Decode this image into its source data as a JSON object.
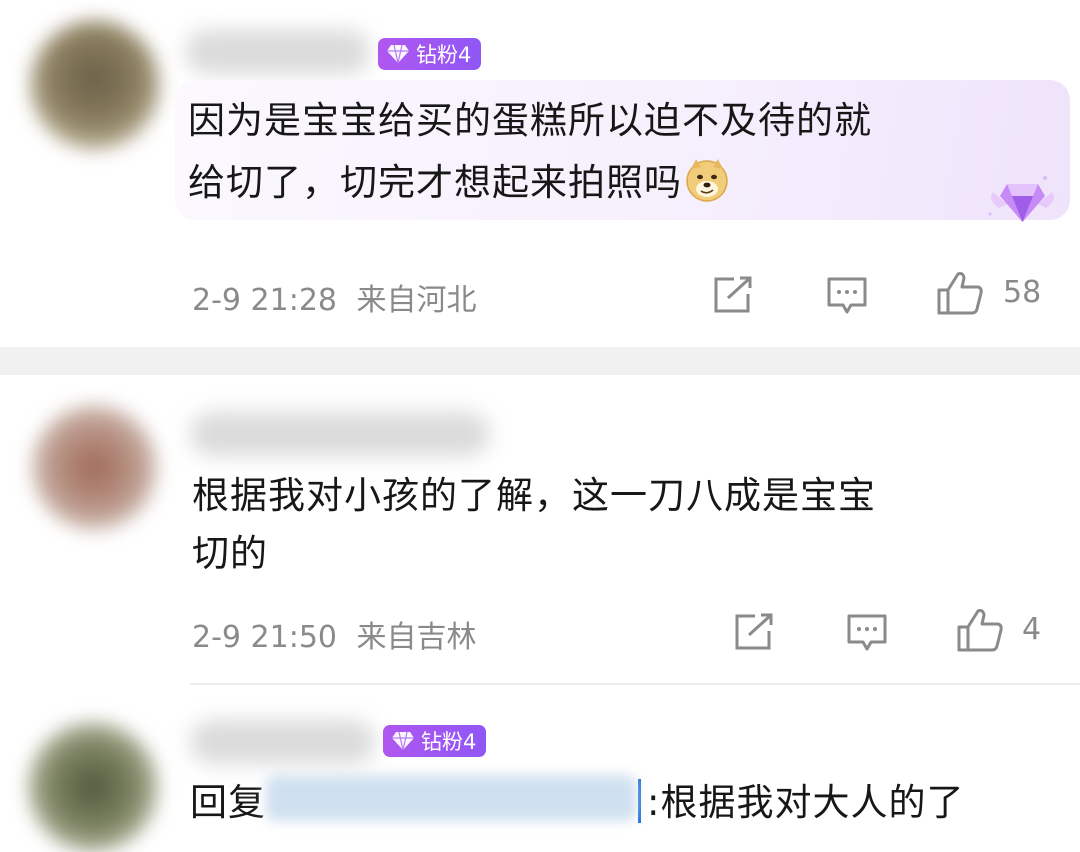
{
  "comments": [
    {
      "badge": "钻粉4",
      "text_line1": "因为是宝宝给买的蛋糕所以迫不及待的就",
      "text_line2": "给切了，切完才想起来拍照吗",
      "emoji": "doge-emoji",
      "date": "2-9 21:28",
      "location": "来自河北",
      "likes": "58"
    },
    {
      "text_line1": "根据我对小孩的了解，这一刀八成是宝宝",
      "text_line2": "切的",
      "date": "2-9 21:50",
      "location": "来自吉林",
      "likes": "4"
    },
    {
      "badge": "钻粉4",
      "reply_prefix": "回复",
      "text_line1": ":根据我对大人的了"
    }
  ],
  "icons": {
    "share": "share-icon",
    "comment": "comment-icon",
    "like": "thumbs-up-icon",
    "decoration": "diamond-wings-icon"
  },
  "colors": {
    "badge": "#9b57f2",
    "meta": "#8a8a8a",
    "reply_link": "#1e6fd9"
  }
}
